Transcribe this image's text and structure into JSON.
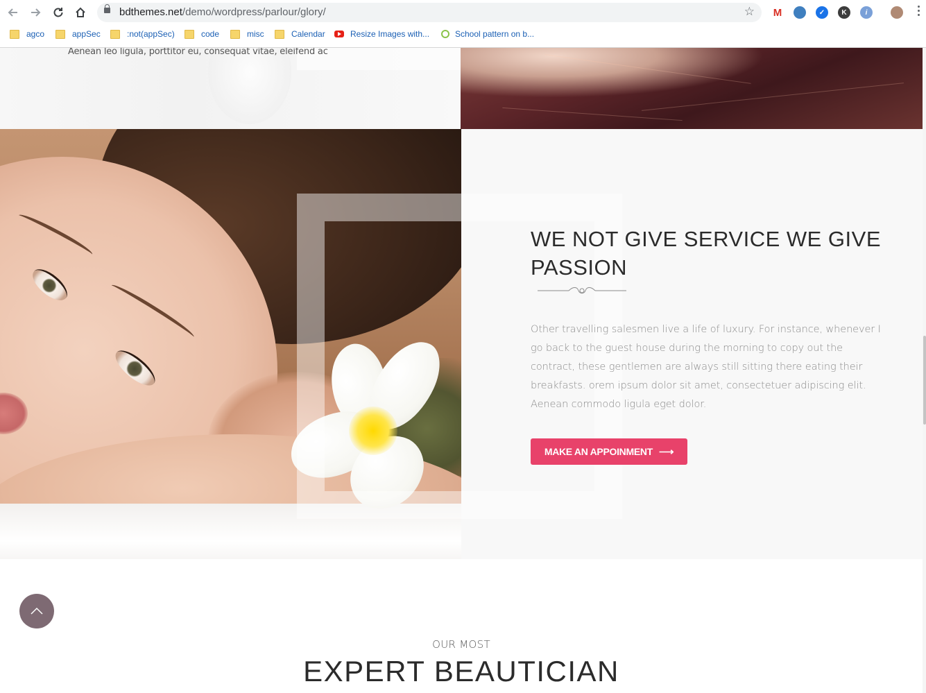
{
  "browser": {
    "url_domain": "bdthemes.net",
    "url_path": "/demo/wordpress/parlour/glory/",
    "back_icon": "arrow-left",
    "forward_icon": "arrow-right",
    "reload_icon": "reload",
    "home_icon": "home",
    "bookmarks": [
      {
        "label": "agco",
        "icon": "folder"
      },
      {
        "label": "appSec",
        "icon": "folder"
      },
      {
        "label": ":not(appSec)",
        "icon": "folder"
      },
      {
        "label": "code",
        "icon": "folder"
      },
      {
        "label": "misc",
        "icon": "folder"
      },
      {
        "label": "Calendar",
        "icon": "folder"
      },
      {
        "label": "Resize Images with...",
        "icon": "youtube"
      },
      {
        "label": "School pattern on b...",
        "icon": "circle-c"
      }
    ],
    "extensions": [
      {
        "name": "gmail-icon",
        "letter": "M",
        "color": "#d93025"
      },
      {
        "name": "globe-extension-icon",
        "letter": "",
        "color": "#3f7fbf"
      },
      {
        "name": "check-extension-icon",
        "letter": "✓",
        "color": "#1a73e8"
      },
      {
        "name": "k-extension-icon",
        "letter": "K",
        "color": "#3c3c3c"
      },
      {
        "name": "info-extension-icon",
        "letter": "i",
        "color": "#7aa0d8"
      }
    ]
  },
  "top_section": {
    "text": "Aenean leo ligula, porttitor eu, consequat vitae, eleifend ac"
  },
  "feature": {
    "heading": "WE NOT GIVE SERVICE WE GIVE PASSION",
    "paragraph": "Other travelling salesmen live a life of luxury. For instance, whenever I go back to the guest house during the morning to copy out the contract, these gentlemen are always still sitting there eating their breakfasts. orem ipsum dolor sit amet, consectetuer adipiscing elit. Aenean commodo ligula eget dolor.",
    "button_label": "MAKE AN APPOINMENT",
    "button_arrow": "⟶",
    "accent_color": "#e8426a"
  },
  "experts": {
    "subtitle": "OUR MOST",
    "title": "EXPERT BEAUTICIAN"
  },
  "scroll_top_icon": "chevron-up"
}
